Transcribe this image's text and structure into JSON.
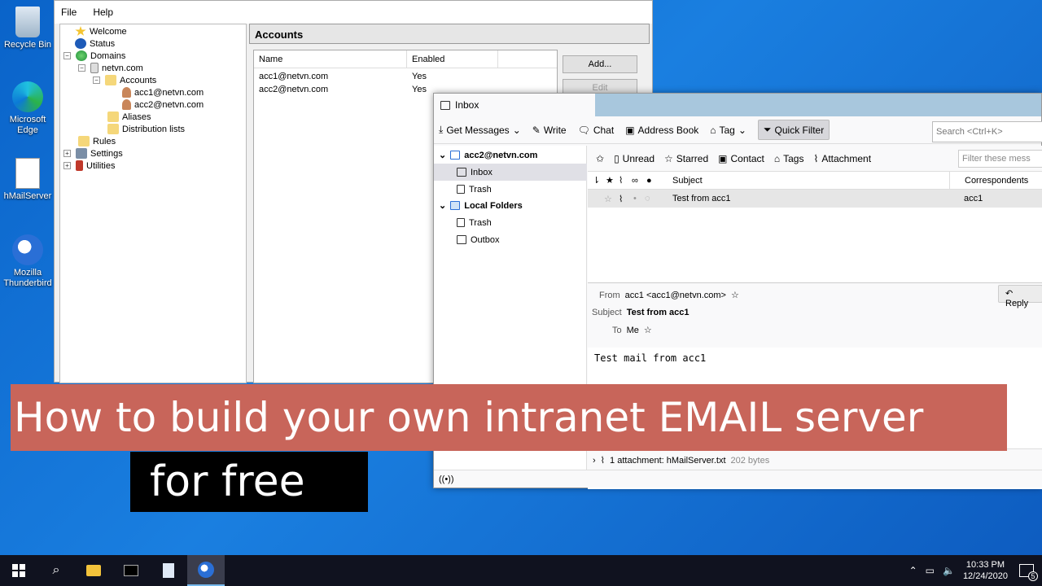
{
  "desktop": {
    "icons": [
      "Recycle Bin",
      "Microsoft Edge",
      "hMailServer",
      "Mozilla Thunderbird"
    ]
  },
  "hmail": {
    "menu": [
      "File",
      "Help"
    ],
    "tree": {
      "welcome": "Welcome",
      "status": "Status",
      "domains": "Domains",
      "domain": "netvn.com",
      "accounts": "Accounts",
      "acc1": "acc1@netvn.com",
      "acc2": "acc2@netvn.com",
      "aliases": "Aliases",
      "distribution": "Distribution lists",
      "rules": "Rules",
      "settings": "Settings",
      "utilities": "Utilities"
    },
    "panel_title": "Accounts",
    "columns": [
      "Name",
      "Enabled"
    ],
    "rows": [
      {
        "name": "acc1@netvn.com",
        "enabled": "Yes"
      },
      {
        "name": "acc2@netvn.com",
        "enabled": "Yes"
      }
    ],
    "add_label": "Add...",
    "edit_label": "Edit"
  },
  "thunderbird": {
    "tab_label": "Inbox",
    "toolbar": {
      "get_messages": "Get Messages",
      "write": "Write",
      "chat": "Chat",
      "address_book": "Address Book",
      "tag": "Tag",
      "quick_filter": "Quick Filter",
      "search_placeholder": "Search <Ctrl+K>"
    },
    "folders": {
      "account": "acc2@netvn.com",
      "inbox": "Inbox",
      "trash": "Trash",
      "local": "Local Folders",
      "local_trash": "Trash",
      "outbox": "Outbox"
    },
    "filter": {
      "unread": "Unread",
      "starred": "Starred",
      "contact": "Contact",
      "tags": "Tags",
      "attachment": "Attachment",
      "placeholder": "Filter these mess"
    },
    "columns": {
      "subject": "Subject",
      "correspondents": "Correspondents"
    },
    "message": {
      "subject": "Test from acc1",
      "correspondent": "acc1"
    },
    "header": {
      "from_label": "From",
      "from_value": "acc1 <acc1@netvn.com>",
      "subject_label": "Subject",
      "subject_value": "Test from acc1",
      "to_label": "To",
      "to_value": "Me",
      "reply": "Reply"
    },
    "body": "Test mail from acc1",
    "attachment": {
      "text": "1 attachment: hMailServer.txt",
      "size": "202 bytes"
    }
  },
  "overlay": {
    "line1": "How to build your own intranet EMAIL server",
    "line2": "for free"
  },
  "taskbar": {
    "time": "10:33 PM",
    "date": "12/24/2020",
    "notifications": "5"
  },
  "colors": {
    "banner": "#c8655a",
    "desktop": "#1a7fe0",
    "taskbar": "#10121f"
  }
}
